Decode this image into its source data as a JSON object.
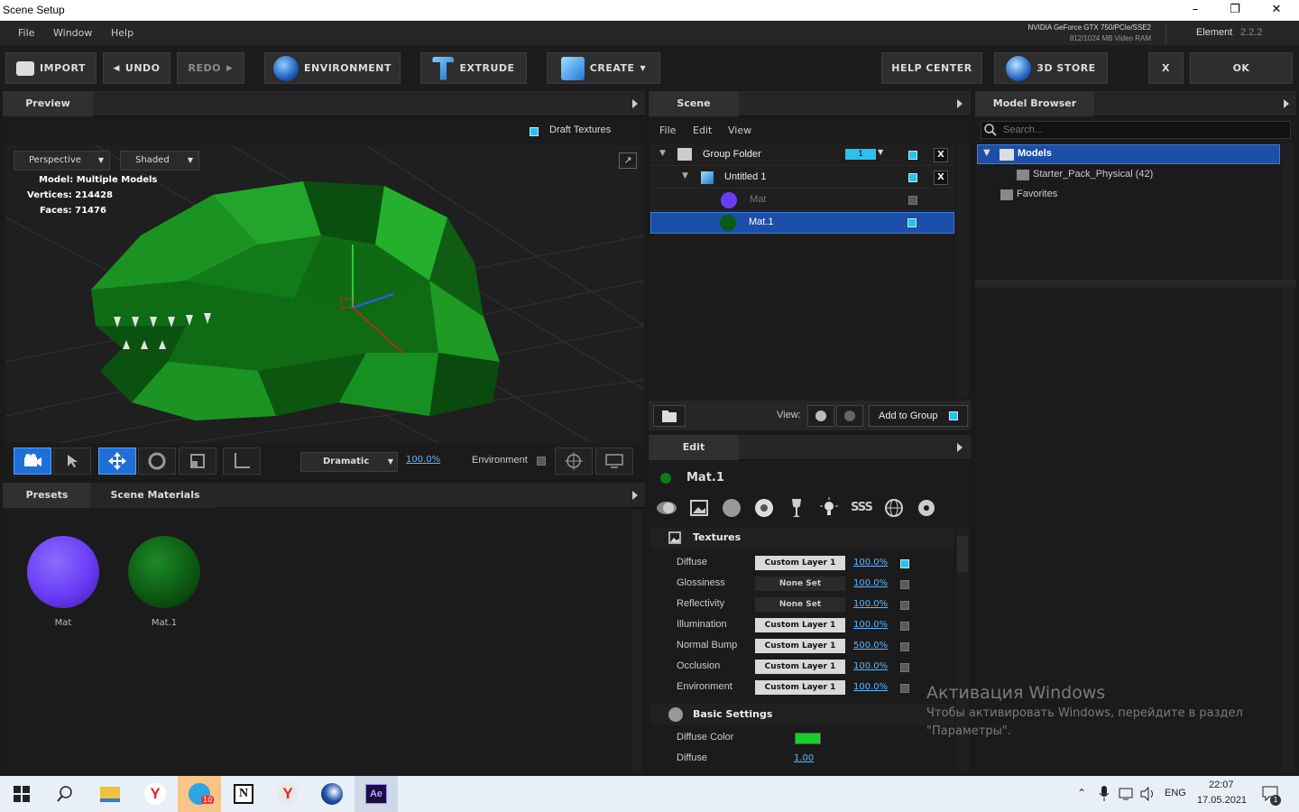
{
  "window": {
    "title": "Scene Setup"
  },
  "menu": [
    "File",
    "Window",
    "Help"
  ],
  "gpu": {
    "name": "NVIDIA GeForce GTX 750/PCIe/SSE2",
    "vram": "812/1024 MB Video RAM"
  },
  "app": {
    "name": "Element",
    "version": "2.2.2"
  },
  "toolbar": {
    "import": "IMPORT",
    "undo": "UNDO",
    "redo": "REDO",
    "environment": "ENVIRONMENT",
    "extrude": "EXTRUDE",
    "create": "CREATE",
    "help_center": "HELP CENTER",
    "store": "3D STORE",
    "close": "X",
    "ok": "OK"
  },
  "preview": {
    "tab": "Preview",
    "draft_textures": "Draft Textures",
    "camera": "Perspective",
    "shading": "Shaded",
    "stats": {
      "model_label": "Model:",
      "model": "Multiple Models",
      "vertices_label": "Vertices:",
      "vertices": "214428",
      "faces_label": "Faces:",
      "faces": "71476"
    },
    "lighting": "Dramatic",
    "intensity": "100.0%",
    "environment": "Environment"
  },
  "materials_panel": {
    "tabs": [
      "Presets",
      "Scene Materials"
    ],
    "items": [
      {
        "name": "Mat",
        "color": "#6a3cf6"
      },
      {
        "name": "Mat.1",
        "color": "#0d5a14"
      }
    ]
  },
  "scene": {
    "tab": "Scene",
    "menu": [
      "File",
      "Edit",
      "View"
    ],
    "rows": [
      {
        "label": "Group Folder",
        "badge": "1"
      },
      {
        "label": "Untitled 1"
      },
      {
        "label": "Mat"
      },
      {
        "label": "Mat.1"
      }
    ],
    "view_label": "View:",
    "add_to_group": "Add to Group"
  },
  "edit": {
    "tab": "Edit",
    "material": "Mat.1",
    "textures_title": "Textures",
    "textures": [
      {
        "name": "Diffuse",
        "layer": "Custom Layer 1",
        "value": "100.0%"
      },
      {
        "name": "Glossiness",
        "layer": "None Set",
        "value": "100.0%"
      },
      {
        "name": "Reflectivity",
        "layer": "None Set",
        "value": "100.0%"
      },
      {
        "name": "Illumination",
        "layer": "Custom Layer 1",
        "value": "100.0%"
      },
      {
        "name": "Normal Bump",
        "layer": "Custom Layer 1",
        "value": "500.0%"
      },
      {
        "name": "Occlusion",
        "layer": "Custom Layer 1",
        "value": "100.0%"
      },
      {
        "name": "Environment",
        "layer": "Custom Layer 1",
        "value": "100.0%"
      }
    ],
    "basic_title": "Basic Settings",
    "diffuse_color_label": "Diffuse Color",
    "diffuse_color": "#17d02c",
    "diffuse_label": "Diffuse",
    "diffuse_value": "1.00"
  },
  "browser": {
    "tab": "Model Browser",
    "search_placeholder": "Search...",
    "tree": [
      {
        "label": "Models"
      },
      {
        "label": "Starter_Pack_Physical (42)"
      },
      {
        "label": "Favorites"
      }
    ]
  },
  "watermark": {
    "title": "Активация Windows",
    "line1": "Чтобы активировать Windows, перейдите в раздел",
    "line2": "\"Параметры\"."
  },
  "taskbar": {
    "lang": "ENG",
    "time": "22:07",
    "date": "17.05.2021",
    "telegram_badge": "10",
    "notification_badge": "1"
  }
}
